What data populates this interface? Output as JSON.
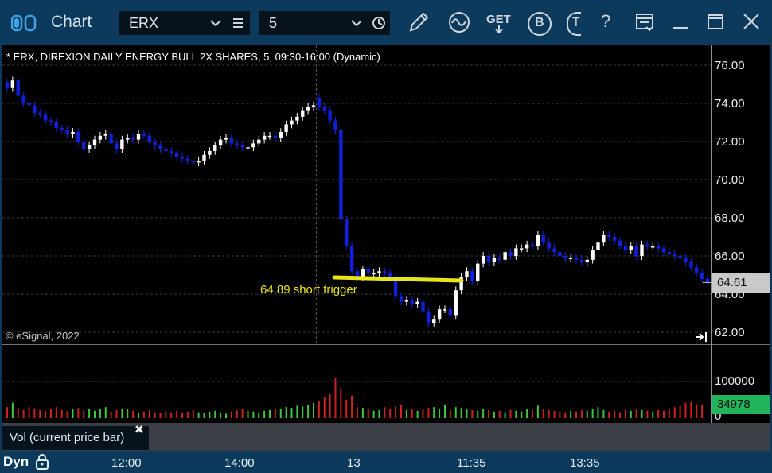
{
  "app": {
    "title": "Chart"
  },
  "toolbar": {
    "symbol": "ERX",
    "interval": "5",
    "get_label": "GET",
    "b_label": "B",
    "t_label": "T",
    "help_label": "?"
  },
  "chart_header": "* ERX, DIREXION DAILY ENERGY BULL 2X SHARES, 5, 09:30-16:00 (Dynamic)",
  "copyright": "© eSignal, 2022",
  "price_axis": {
    "ticks": [
      "76.00",
      "74.00",
      "72.00",
      "70.00",
      "68.00",
      "66.00",
      "64.00",
      "62.00"
    ],
    "last_price": "64.61"
  },
  "volume_axis": {
    "ticks": [
      "100000",
      "0"
    ],
    "last_volume": "34978"
  },
  "volume_study": {
    "label": "Vol (current price bar)",
    "close_symbol": "✖"
  },
  "annotation": {
    "text": "64.89 short trigger",
    "price": 64.89,
    "color": "#e6e619"
  },
  "time_axis": {
    "mode": "Dyn",
    "labels": [
      "12:00",
      "14:00",
      "13",
      "11:35",
      "13:35"
    ]
  },
  "colors": {
    "up": "#ffffff",
    "down": "#1020e0",
    "vol_up": "#38c838",
    "vol_down": "#d02020",
    "background": "#000000"
  },
  "chart_data": {
    "type": "candlestick",
    "title": "* ERX, DIREXION DAILY ENERGY BULL 2X SHARES, 5, 09:30-16:00 (Dynamic)",
    "ylim": [
      61.5,
      77
    ],
    "y_ticks": [
      62,
      64,
      66,
      68,
      70,
      72,
      74,
      76
    ],
    "x_labels": [
      "12:00",
      "14:00",
      "13",
      "11:35",
      "13:35"
    ],
    "session_break_after_index": 56,
    "closes": [
      74.8,
      75.2,
      74.4,
      74.0,
      73.9,
      73.5,
      73.4,
      73.1,
      73.0,
      72.7,
      72.6,
      72.4,
      72.5,
      72.0,
      71.6,
      71.8,
      72.1,
      72.3,
      72.4,
      71.9,
      71.6,
      72.1,
      72.2,
      72.1,
      72.4,
      72.3,
      72.0,
      71.8,
      71.6,
      71.5,
      71.4,
      71.2,
      71.1,
      71.0,
      70.9,
      71.0,
      71.3,
      71.5,
      71.8,
      72.1,
      72.2,
      71.9,
      71.8,
      71.7,
      71.7,
      71.9,
      72.1,
      72.3,
      72.3,
      72.2,
      72.5,
      72.9,
      73.1,
      73.3,
      73.6,
      73.8,
      73.9,
      73.8,
      73.6,
      73.1,
      72.6,
      67.9,
      66.5,
      65.2,
      64.9,
      65.3,
      65.1,
      65.1,
      65.2,
      65.1,
      64.9,
      63.9,
      63.6,
      63.7,
      63.5,
      63.6,
      63.1,
      62.5,
      62.7,
      63.2,
      63.2,
      62.9,
      64.2,
      64.9,
      65.2,
      64.7,
      65.6,
      66.0,
      65.7,
      65.9,
      65.8,
      66.2,
      66.0,
      66.4,
      66.4,
      66.6,
      66.5,
      67.1,
      66.7,
      66.4,
      66.2,
      66.0,
      65.9,
      65.9,
      65.8,
      65.7,
      65.8,
      66.3,
      66.7,
      67.1,
      67.0,
      66.8,
      66.5,
      66.3,
      66.5,
      66.0,
      66.6,
      66.5,
      66.5,
      66.4,
      66.2,
      66.1,
      66.0,
      65.9,
      65.7,
      65.4,
      65.1,
      64.8,
      64.61
    ],
    "volume": [
      30000,
      42000,
      28000,
      22000,
      30000,
      27000,
      22000,
      20000,
      26000,
      30000,
      22000,
      19000,
      24000,
      28000,
      22000,
      26000,
      20000,
      24000,
      30000,
      18000,
      22000,
      26000,
      24000,
      20000,
      14000,
      18000,
      22000,
      16000,
      15000,
      18000,
      16000,
      20000,
      14000,
      18000,
      22000,
      16000,
      15000,
      18000,
      20000,
      14000,
      12000,
      18000,
      22000,
      26000,
      20000,
      18000,
      16000,
      20000,
      22000,
      26000,
      24000,
      30000,
      28000,
      34000,
      32000,
      36000,
      42000,
      48000,
      58000,
      66000,
      110000,
      82000,
      50000,
      62000,
      30000,
      28000,
      24000,
      20000,
      22000,
      30000,
      26000,
      32000,
      36000,
      22000,
      26000,
      20000,
      24000,
      28000,
      30000,
      24000,
      36000,
      22000,
      30000,
      28000,
      26000,
      22000,
      20000,
      24000,
      22000,
      18000,
      20000,
      16000,
      22000,
      20000,
      18000,
      24000,
      22000,
      34000,
      26000,
      22000,
      20000,
      18000,
      16000,
      20000,
      18000,
      22000,
      20000,
      26000,
      30000,
      22000,
      18000,
      20000,
      16000,
      22000,
      20000,
      24000,
      22000,
      20000,
      18000,
      22000,
      20000,
      26000,
      30000,
      34000,
      42000,
      44000,
      38000,
      34978
    ]
  }
}
